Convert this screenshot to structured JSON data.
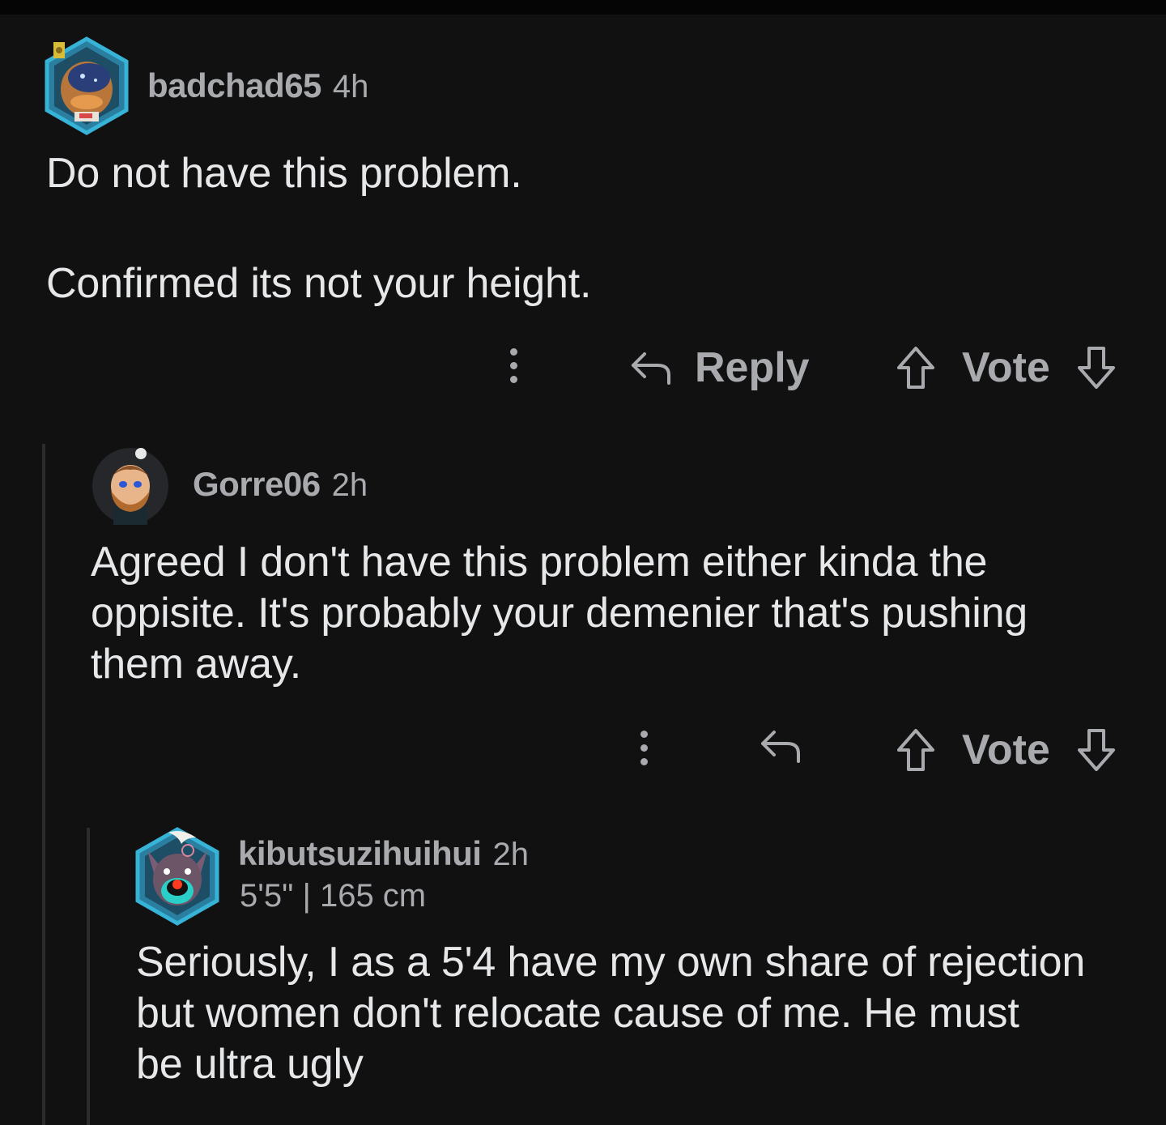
{
  "comments": [
    {
      "username": "badchad65",
      "time": "4h",
      "body": "Do not have this problem.\n\nConfirmed its not your height.",
      "actions": {
        "reply_label": "Reply",
        "vote_label": "Vote"
      }
    },
    {
      "username": "Gorre06",
      "time": "2h",
      "body": "Agreed I don't have this problem either kinda the\noppisite. It's probably your demenier that's pushing\nthem away.",
      "actions": {
        "vote_label": "Vote"
      }
    },
    {
      "username": "kibutsuzihuihui",
      "time": "2h",
      "flair": "5'5\" | 165 cm",
      "body": "Seriously, I as a 5'4 have my own share of rejection\nbut women don't relocate cause of me. He must\nbe ultra ugly"
    }
  ],
  "icons": {
    "more": "more-vertical-icon",
    "reply": "reply-arrow-icon",
    "upvote": "upvote-arrow-icon",
    "downvote": "downvote-arrow-icon"
  },
  "colors": {
    "background": "#111112",
    "text": "#e6e7e9",
    "muted": "#a8aaad",
    "thread_line": "#2b2c2e"
  }
}
